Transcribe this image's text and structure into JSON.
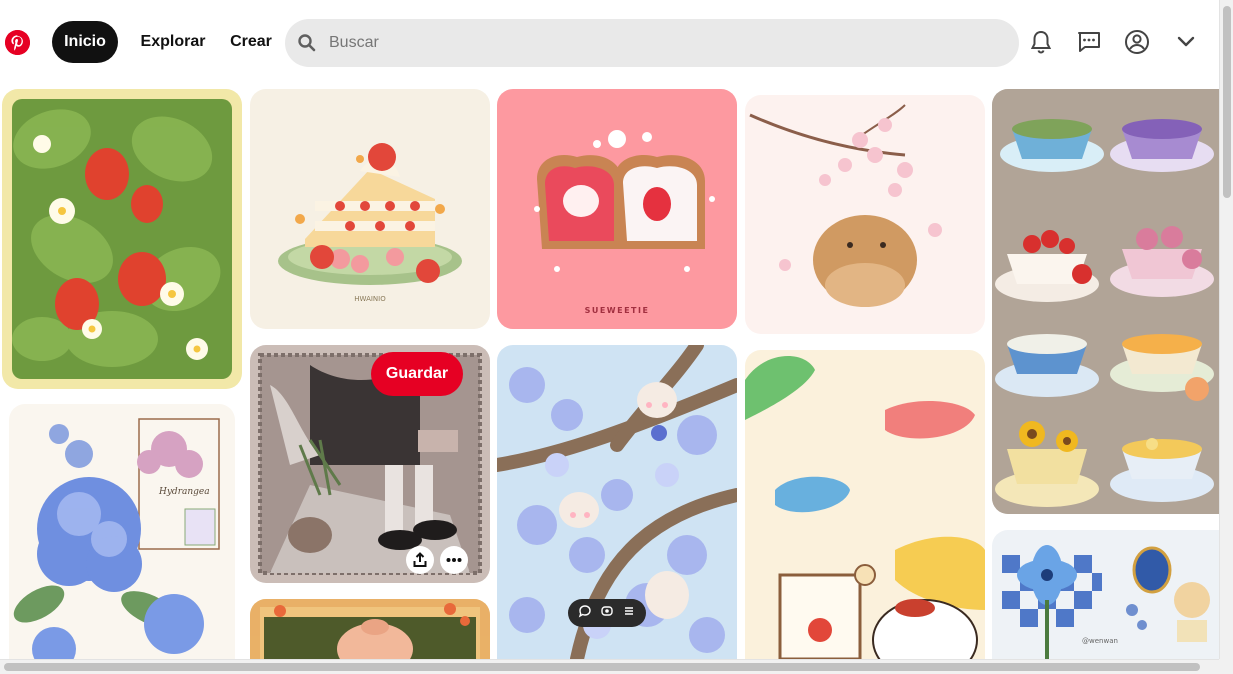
{
  "nav": {
    "home_label": "Inicio",
    "explore_label": "Explorar",
    "create_label": "Crear"
  },
  "search": {
    "placeholder": "Buscar",
    "value": ""
  },
  "icons": {
    "logo": "pinterest-logo-icon",
    "search": "search-icon",
    "notifications": "bell-icon",
    "messages": "chat-icon",
    "profile": "user-icon",
    "account_menu": "chevron-down-icon"
  },
  "pins": {
    "cake_signature": "HWAINIO",
    "toast_caption": "SUEWEETIE",
    "hydrangea_title": "Hydrangea",
    "teapot_signature": "@wenwan"
  },
  "hovered_pin": {
    "save_label": "Guardar"
  },
  "colors": {
    "brand": "#e60023",
    "active_nav": "#111111",
    "search_bg": "#e9e9e9"
  }
}
